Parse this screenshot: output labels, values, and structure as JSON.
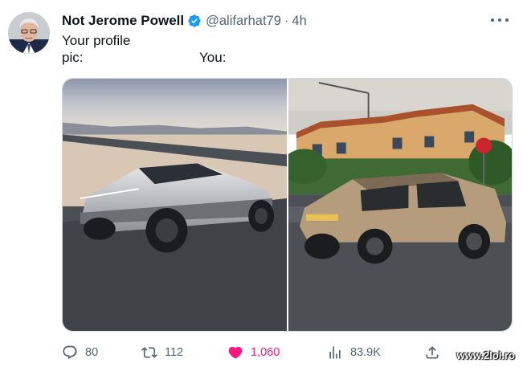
{
  "tweet": {
    "display_name": "Not Jerome Powell",
    "handle": "@alifarhat79",
    "separator": "·",
    "time": "4h",
    "text_line1": "Your profile",
    "text_line2_left": "pic:",
    "text_line2_right": "You:"
  },
  "icons": {
    "avatar": "avatar-portrait",
    "verified": "verified-badge-icon",
    "more": "more-options-icon"
  },
  "media": {
    "left_photo": "tesla-cybertruck-photo",
    "right_photo": "cardboard-cybertruck-photo"
  },
  "actions": {
    "replies": "80",
    "retweets": "112",
    "likes": "1,060",
    "views": "83.9K"
  },
  "watermark": "www.2lol.ro",
  "colors": {
    "verified": "#1d9bf0",
    "like": "#f91880",
    "muted": "#536471"
  }
}
